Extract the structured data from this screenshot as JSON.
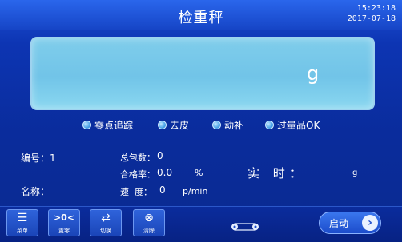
{
  "header": {
    "title": "检重秤",
    "time": "15:23:18",
    "date": "2017-07-18"
  },
  "display": {
    "unit": "g"
  },
  "indicators": [
    {
      "label": "零点追踪"
    },
    {
      "label": "去皮"
    },
    {
      "label": "动补"
    },
    {
      "label": "过量品OK"
    }
  ],
  "info": {
    "number_label": "编号：1",
    "name_label": "名称：",
    "total_label": "总包数：",
    "total_value": "0",
    "pass_rate_label": "合格率：",
    "pass_rate_value": "0.0",
    "pass_rate_unit": "%",
    "speed_label": "速  度：",
    "speed_value": "0",
    "speed_unit": "p/min",
    "realtime_label": "实 时：",
    "realtime_unit": "g"
  },
  "toolbar": {
    "menu": "菜单",
    "zero": "置零",
    "switch": "切换",
    "clear": "清除",
    "start": "启动"
  },
  "icons": [
    "menu-icon",
    "zero-icon",
    "switch-icon",
    "clear-icon",
    "conveyor-icon",
    "arrow-right-icon"
  ],
  "colors": {
    "background": "#0a2c9c",
    "display": "#78c8ea",
    "indicator": "#4aa2e8"
  }
}
